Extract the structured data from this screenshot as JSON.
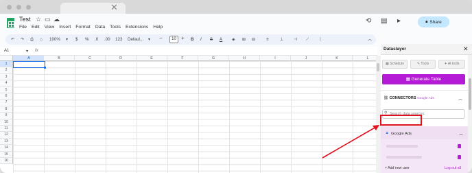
{
  "browser": {
    "close_glyph": "✕"
  },
  "doc": {
    "title": "Test"
  },
  "menu": [
    "File",
    "Edit",
    "View",
    "Insert",
    "Format",
    "Data",
    "Tools",
    "Extensions",
    "Help"
  ],
  "share": {
    "label": "Share"
  },
  "toolbar": {
    "zoom": "100%",
    "currency": "$",
    "percent": "%",
    "dec_dec": ".0",
    "dec_inc": ".00",
    "number_fmt": "123",
    "font": "Defaul...",
    "font_size": "10",
    "bold": "B",
    "italic": "I",
    "strike": "S",
    "text_color": "A"
  },
  "formula_bar": {
    "cell_ref": "A1",
    "fx": "fx"
  },
  "grid": {
    "columns": [
      "A",
      "B",
      "C",
      "D",
      "E",
      "F",
      "G",
      "H",
      "I",
      "J",
      "K",
      "L"
    ],
    "rows": [
      "1",
      "2",
      "3",
      "4",
      "5",
      "6",
      "7",
      "8",
      "9",
      "10",
      "11",
      "12",
      "13",
      "14",
      "15",
      "16"
    ]
  },
  "sidebar": {
    "title": "Dataslayer",
    "close_glyph": "✕",
    "tabs": [
      "Schedule",
      "Tools",
      "AI tools"
    ],
    "generate_label": "Generate Table",
    "connectors_label": "CONNECTORS",
    "connectors_sub": "Google Ads",
    "search_placeholder": "Search data sources",
    "connector_name": "Google Ads",
    "add_user": "+ Add new user",
    "logout": "Log out all"
  },
  "colors": {
    "accent": "#b41bd6",
    "highlight": "#e0101e",
    "share_bg": "#c2e7ff",
    "sheets_green": "#1fa463"
  }
}
